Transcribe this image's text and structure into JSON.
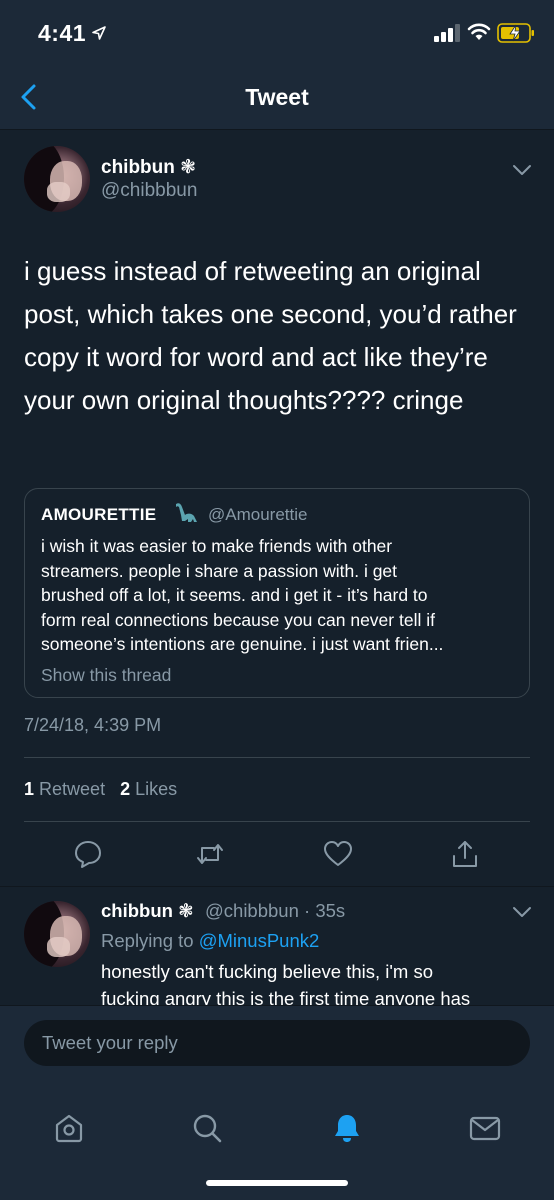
{
  "status_bar": {
    "time": "4:41",
    "location_icon": "location-arrow-icon",
    "signal_icon": "cellular-signal-icon",
    "wifi_icon": "wifi-icon",
    "battery_icon": "battery-charging-icon"
  },
  "nav": {
    "back_icon": "chevron-left-icon",
    "title": "Tweet"
  },
  "tweet": {
    "author_name": "chibbun ❃",
    "author_handle": "@chibbbun",
    "more_icon": "chevron-down-icon",
    "text": "i guess instead of retweeting an original post, which takes one second,  you’d rather copy it word for word and act like they’re your own  original thoughts???? cringe",
    "quoted": {
      "author_name": "AMOURETTIE",
      "emoji": "sauropod-icon",
      "author_handle": "@Amourettie",
      "lines": [
        "i wish it was easier to make friends with other",
        "streamers. people i share a passion with. i get",
        "brushed off a lot, it seems. and i get it - it’s hard to",
        "form real connections because you can never tell if",
        "someone’s intentions are genuine. i just want frien..."
      ],
      "show_thread": "Show this thread"
    },
    "timestamp": "7/24/18, 4:39 PM",
    "retweet_count": "1",
    "retweet_label": "Retweet",
    "like_count": "2",
    "like_label": "Likes",
    "actions": [
      "reply-icon",
      "retweet-icon",
      "like-icon",
      "share-icon"
    ]
  },
  "reply": {
    "author_name": "chibbun ❃",
    "meta": "@chibbbun · 35s",
    "replying_prefix": "Replying to",
    "replying_to": "@MinusPunk2",
    "lines": [
      "honestly can't fucking believe this, i'm so",
      "fucking angry this is the first time anyone has"
    ]
  },
  "compose": {
    "placeholder": "Tweet your reply"
  },
  "tabs": [
    "home-icon",
    "search-icon",
    "notifications-icon",
    "messages-icon"
  ],
  "colors": {
    "background": "#15202b",
    "bar": "#1c2938",
    "accent": "#1da1f2",
    "secondary_text": "#8899a6"
  }
}
